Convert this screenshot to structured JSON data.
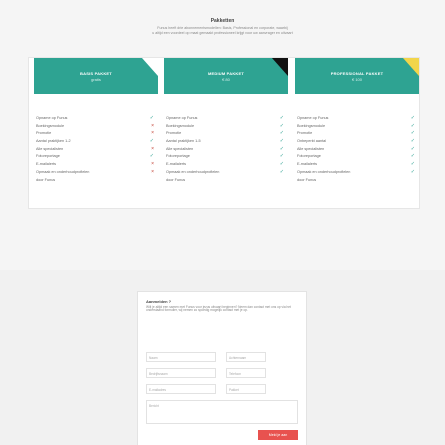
{
  "header": {
    "title": "Pakketten",
    "subtitle_line1": "Funus heeft drie abonnementsmodellen: Basis, Professional en corporate, waarbij",
    "subtitle_line2": "u altijd een voordeel op maat gemaakt professioneel krijgt voor uw aanvrager en uitvaart"
  },
  "plans": [
    {
      "name": "BASIS PAKKET",
      "price": "gratis",
      "corner_color": "#ffffff",
      "features": [
        {
          "label": "Opname op Funus",
          "included": true
        },
        {
          "label": "Boekingsmodule",
          "included": false
        },
        {
          "label": "Promotie",
          "included": false
        },
        {
          "label": "Aantal praktijken 1-2",
          "included": true
        },
        {
          "label": "Alle specialisten",
          "included": false
        },
        {
          "label": "Fotoreportage",
          "included": true
        },
        {
          "label": "E-mailalerts",
          "included": false
        },
        {
          "label": "Opmaak en onderhoudprofielen",
          "included": false
        },
        {
          "label": "door Funus",
          "included": null
        }
      ]
    },
    {
      "name": "MEDIUM PAKKET",
      "price": "€ 80",
      "corner_color": "#111111",
      "features": [
        {
          "label": "Opname op Funus",
          "included": true
        },
        {
          "label": "Boekingsmodule",
          "included": true
        },
        {
          "label": "Promotie",
          "included": true
        },
        {
          "label": "Aantal praktijken 1-5",
          "included": true
        },
        {
          "label": "Alle specialisten",
          "included": true
        },
        {
          "label": "Fotoreportage",
          "included": true
        },
        {
          "label": "E-mailalerts",
          "included": true
        },
        {
          "label": "Opmaak en onderhoudprofielen",
          "included": true
        },
        {
          "label": "door Funus",
          "included": null
        }
      ]
    },
    {
      "name": "PROFESSIONAL PAKKET",
      "price": "€ 100",
      "corner_color": "#f2d54a",
      "features": [
        {
          "label": "Opname op Funus",
          "included": true
        },
        {
          "label": "Boekingsmodule",
          "included": true
        },
        {
          "label": "Promotie",
          "included": true
        },
        {
          "label": "Onbeperkt aantal",
          "included": true
        },
        {
          "label": "Alle specialisten",
          "included": true
        },
        {
          "label": "Fotoreportage",
          "included": true
        },
        {
          "label": "E-mailalerts",
          "included": true
        },
        {
          "label": "Opmaak en onderhoudprofielen",
          "included": true
        },
        {
          "label": "door Funus",
          "included": null
        }
      ]
    }
  ],
  "form": {
    "title": "Aanmelden ?",
    "subtitle": "Wilt je altijd een samen met Funus voor jezus uitvaart beginnen? Neem dan contact met ons op via het onderstaand formulier, wij nemen zo spoedig mogelijk contact met je op.",
    "placeholders": {
      "naam": "Naam",
      "achternaam": "Achternaam",
      "bedrijfsnaam": "Bedrijfsnaam",
      "telefoon": "Telefoon",
      "email": "E-mailadres",
      "pakket": "Pakket",
      "bericht": "Bericht"
    },
    "submit_label": "Meld je aan"
  },
  "icons": {
    "yes": "check-icon",
    "no": "cross-icon"
  }
}
